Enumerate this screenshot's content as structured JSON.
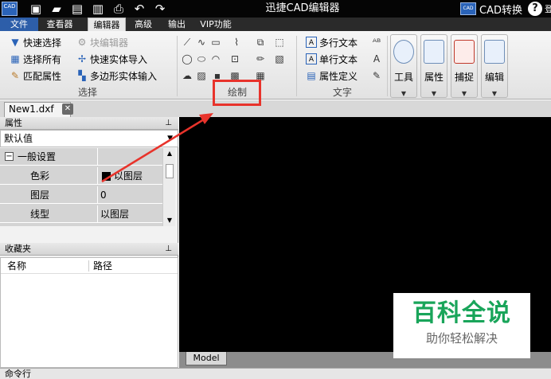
{
  "titlebar": {
    "logo_text": "CAD",
    "app_title": "迅捷CAD编辑器",
    "cad_convert_badge": "CAD",
    "cad_convert_label": "CAD转换",
    "help_label": "?",
    "user_fragment": "登"
  },
  "tabs": [
    "文件",
    "查看器",
    "编辑器",
    "高级",
    "输出",
    "VIP功能"
  ],
  "ribbon": {
    "select_group": {
      "items": [
        "快速选择",
        "选择所有",
        "匹配属性"
      ],
      "label": "选择"
    },
    "block_group": {
      "items": [
        "块编辑器",
        "快速实体导入",
        "多边形实体输入"
      ]
    },
    "draw_group": {
      "label": "绘制"
    },
    "text_group": {
      "items": [
        "多行文本",
        "单行文本",
        "属性定义"
      ],
      "label": "文字"
    },
    "big_buttons": [
      "工具",
      "属性",
      "捕捉",
      "编辑"
    ]
  },
  "document_tab": {
    "name": "New1.dxf"
  },
  "properties_panel": {
    "title": "属性",
    "selector_value": "默认值",
    "section": "一般设置",
    "rows": [
      {
        "name": "色彩",
        "value": "以图层"
      },
      {
        "name": "图层",
        "value": "0"
      },
      {
        "name": "线型",
        "value": "以图层"
      }
    ]
  },
  "favorites_panel": {
    "title": "收藏夹",
    "columns": [
      "名称",
      "路径"
    ]
  },
  "model_tab": "Model",
  "command_bar": "命令行",
  "watermark": {
    "title": "百科全说",
    "subtitle": "助你轻松解决"
  },
  "colors": {
    "accent": "#2d5ea9",
    "highlight": "#e8332b",
    "watermark_green": "#19a55a"
  }
}
